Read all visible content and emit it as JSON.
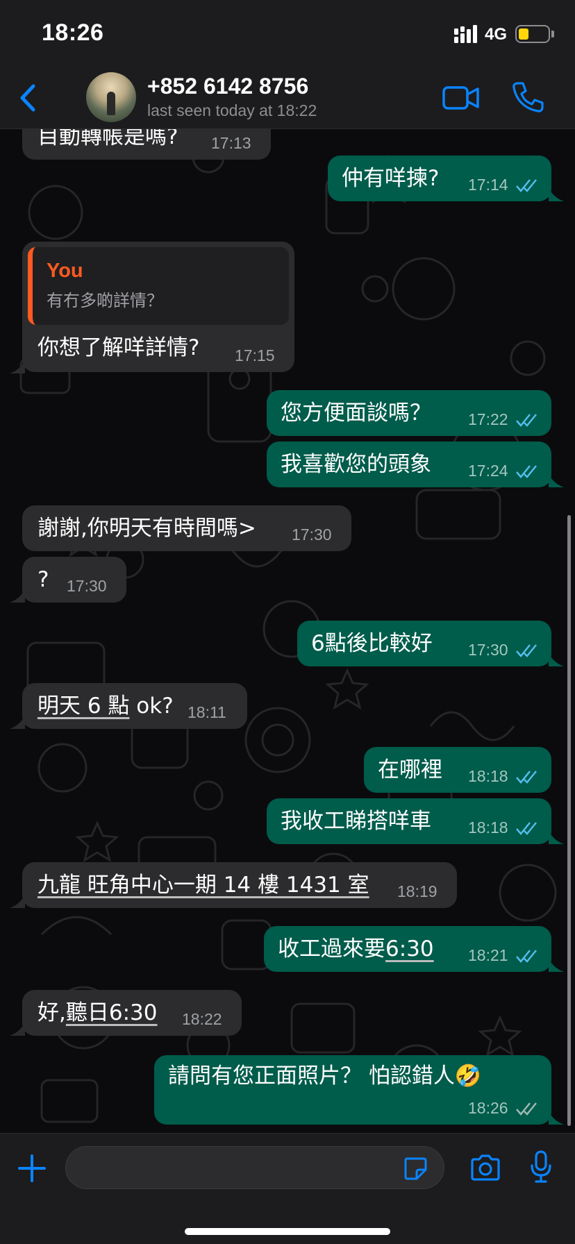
{
  "status_bar": {
    "time": "18:26",
    "network": "4G",
    "battery_level": 0.3
  },
  "header": {
    "contact_name": "+852 6142 8756",
    "last_seen": "last seen today at 18:22",
    "icons": {
      "back": "chevron-left-icon",
      "video": "video-camera-icon",
      "call": "phone-icon"
    }
  },
  "messages": [
    {
      "dir": "in",
      "text": "目動轉帳是嗎?",
      "time": "17:13"
    },
    {
      "dir": "out",
      "text": "仲有咩揀?",
      "time": "17:14",
      "status": "read"
    },
    {
      "dir": "in",
      "quote": {
        "author": "You",
        "text": "有冇多啲詳情？"
      },
      "text": "你想了解咩詳情?",
      "time": "17:15"
    },
    {
      "dir": "out",
      "text": "您方便面談嗎？",
      "time": "17:22",
      "status": "read"
    },
    {
      "dir": "out",
      "text": "我喜歡您的頭象",
      "time": "17:24",
      "status": "read"
    },
    {
      "dir": "in",
      "text": "謝謝,你明天有時間嗎>",
      "time": "17:30"
    },
    {
      "dir": "in",
      "text": "?",
      "time": "17:30"
    },
    {
      "dir": "out",
      "text": "6點後比較好",
      "time": "17:30",
      "status": "read"
    },
    {
      "dir": "in",
      "link": "明天 6 點",
      "text": " ok?",
      "time": "18:11"
    },
    {
      "dir": "out",
      "text": "在哪裡",
      "time": "18:18",
      "status": "read"
    },
    {
      "dir": "out",
      "text": "我收工睇搭咩車",
      "time": "18:18",
      "status": "read"
    },
    {
      "dir": "in",
      "link": "九龍 旺角中心一期 14 樓 1431 室",
      "text": "",
      "time": "18:19"
    },
    {
      "dir": "out",
      "text": "收工過來要",
      "link": "6:30",
      "time": "18:21",
      "status": "read"
    },
    {
      "dir": "in",
      "text": "好,",
      "link": "聽日6:30",
      "time": "18:22"
    },
    {
      "dir": "out",
      "text": "請問有您正面照片？ 怕認錯人🤣",
      "time": "18:26",
      "status": "delivered"
    }
  ],
  "composer": {
    "placeholder": "",
    "icons": {
      "attach": "plus-icon",
      "sticker": "sticker-icon",
      "camera": "camera-icon",
      "mic": "microphone-icon"
    }
  },
  "colors": {
    "accent": "#0a84ff",
    "outgoing_bubble": "#005c4b",
    "incoming_bubble": "#2c2c2e",
    "quote_author": "#ff5a1f",
    "read_ticks": "#53bdeb"
  }
}
